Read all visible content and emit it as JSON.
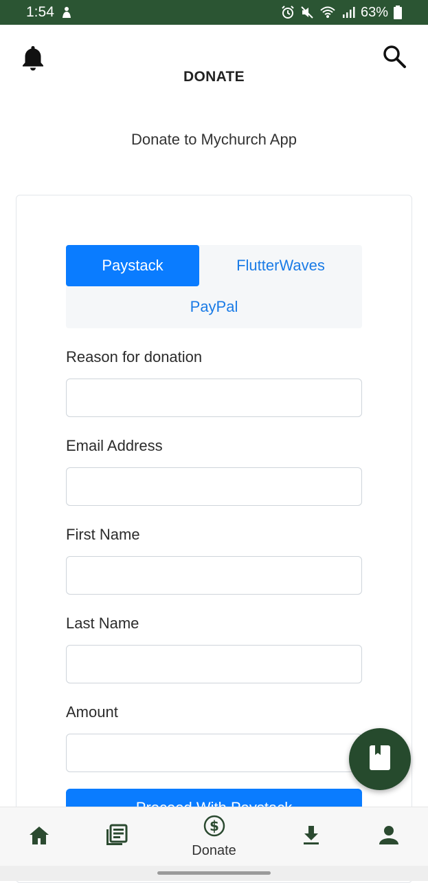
{
  "status_bar": {
    "time": "1:54",
    "battery": "63%",
    "left_icons": [
      "silhouette-icon"
    ],
    "right_icons": [
      "alarm-icon",
      "mute-icon",
      "wifi-icon",
      "signal-icon",
      "battery-icon"
    ]
  },
  "header": {
    "title": "DONATE",
    "left_icon": "bell-icon",
    "right_icon": "search-icon"
  },
  "subtitle": "Donate to Mychurch App",
  "payment_tabs": [
    {
      "label": "Paystack",
      "active": true
    },
    {
      "label": "FlutterWaves",
      "active": false
    },
    {
      "label": "PayPal",
      "active": false
    }
  ],
  "form": {
    "reason": {
      "label": "Reason for donation",
      "value": "",
      "placeholder": ""
    },
    "email": {
      "label": "Email Address",
      "value": "",
      "placeholder": ""
    },
    "first_name": {
      "label": "First Name",
      "value": "",
      "placeholder": ""
    },
    "last_name": {
      "label": "Last Name",
      "value": "",
      "placeholder": ""
    },
    "amount": {
      "label": "Amount",
      "value": "",
      "placeholder": ""
    },
    "submit_label": "Proceed With Paystack"
  },
  "fab": {
    "icon": "book-icon"
  },
  "bottom_nav": [
    {
      "id": "home",
      "icon": "home-icon",
      "label": ""
    },
    {
      "id": "articles",
      "icon": "articles-icon",
      "label": ""
    },
    {
      "id": "donate",
      "icon": "dollar-circle-icon",
      "label": "Donate"
    },
    {
      "id": "downloads",
      "icon": "download-icon",
      "label": ""
    },
    {
      "id": "profile",
      "icon": "person-icon",
      "label": ""
    }
  ],
  "colors": {
    "status_bar": "#2b5533",
    "primary_blue": "#0a7cff",
    "nav_icon": "#2b4a30",
    "fab": "#264a2d"
  }
}
